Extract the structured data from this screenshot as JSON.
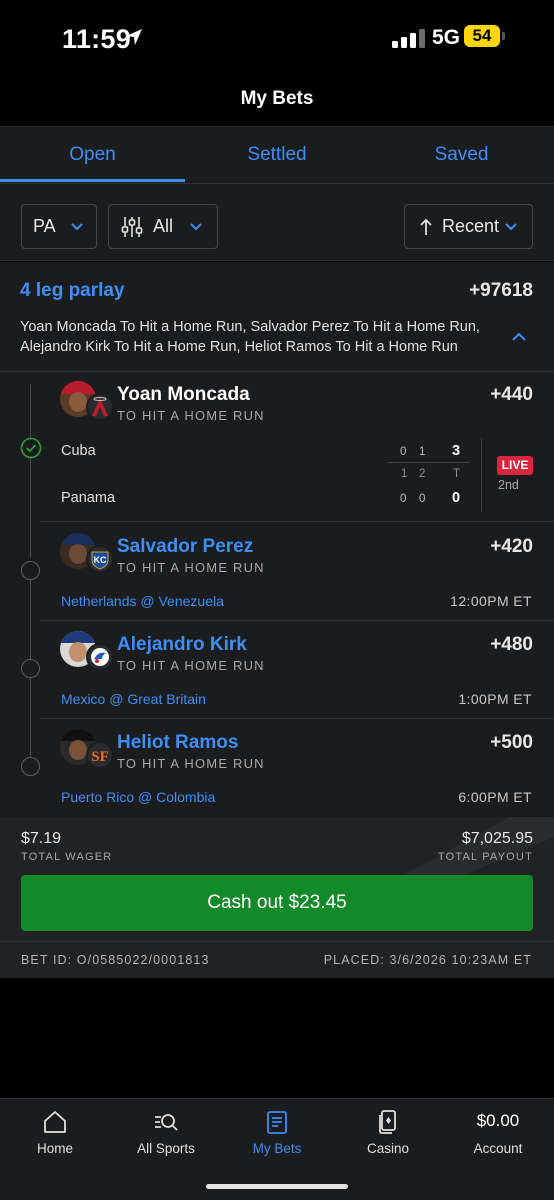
{
  "status_bar": {
    "time": "11:59",
    "network": "5G",
    "battery": "54"
  },
  "header": {
    "title": "My Bets"
  },
  "tabs": [
    {
      "label": "Open",
      "active": true
    },
    {
      "label": "Settled",
      "active": false
    },
    {
      "label": "Saved",
      "active": false
    }
  ],
  "filters": {
    "state": "PA",
    "type": "All",
    "sort": "Recent"
  },
  "parlay": {
    "title": "4 leg parlay",
    "odds": "+97618",
    "summary": "Yoan Moncada To Hit a Home Run, Salvador Perez To Hit a Home Run, Alejandro Kirk To Hit a Home Run, Heliot Ramos To Hit a Home Run"
  },
  "legs": [
    {
      "player": "Yoan Moncada",
      "market": "TO HIT A HOME RUN",
      "odds": "+440"
    },
    {
      "player": "Salvador Perez",
      "market": "TO HIT A HOME RUN",
      "odds": "+420",
      "game": "Netherlands @ Venezuela",
      "time": "12:00PM ET"
    },
    {
      "player": "Alejandro Kirk",
      "market": "TO HIT A HOME RUN",
      "odds": "+480",
      "game": "Mexico @ Great Britain",
      "time": "1:00PM ET"
    },
    {
      "player": "Heliot Ramos",
      "market": "TO HIT A HOME RUN",
      "odds": "+500",
      "game": "Puerto Rico @ Colombia",
      "time": "6:00PM ET"
    }
  ],
  "scoreboard": {
    "team1": "Cuba",
    "team2": "Panama",
    "team1_innings": [
      "0",
      "1"
    ],
    "team2_innings": [
      "0",
      "0"
    ],
    "innings_labels": [
      "1",
      "2"
    ],
    "total_label": "T",
    "team1_total": "3",
    "team2_total": "0",
    "live_label": "LIVE",
    "inning": "2nd"
  },
  "totals": {
    "wager": "$7.19",
    "wager_label": "TOTAL WAGER",
    "payout": "$7,025.95",
    "payout_label": "TOTAL PAYOUT"
  },
  "cashout": {
    "label": "Cash out $23.45"
  },
  "bet_meta": {
    "bet_id": "BET ID: O/0585022/0001813",
    "placed": "PLACED: 3/6/2026 10:23AM ET"
  },
  "nav": [
    {
      "label": "Home",
      "icon": "home-icon"
    },
    {
      "label": "All Sports",
      "icon": "search-icon"
    },
    {
      "label": "My Bets",
      "icon": "betslip-icon",
      "active": true
    },
    {
      "label": "Casino",
      "icon": "cards-icon"
    },
    {
      "label": "Account",
      "value": "$0.00"
    }
  ],
  "colors": {
    "accent": "#3d8ff5",
    "cashout": "#138a2a",
    "live": "#d7263d",
    "battery": "#ffd60a"
  }
}
